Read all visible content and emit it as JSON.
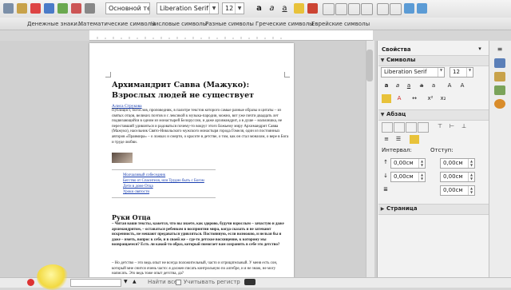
{
  "toolbar": {
    "para_style": "Основной текст",
    "font_name": "Liberation Serif",
    "font_size": "12"
  },
  "symbols": [
    "Денежные знаки...",
    "Математические символы",
    "Числовые символы",
    "Разные символы",
    "Греческие символы",
    "Еврейские символы"
  ],
  "doc": {
    "title": "Архимандрит Савва (Мажуко): Взрослых людей не существует",
    "author": "Алиса Струкова",
    "paragraph1": "Публицист, богослов, проповедник, в палитре текстов которого самые разные образы и цитаты – из святых отцов, великих поэтов и с лексикой к музыка-пародии, можно, вот уже почти двадцать лет подвизающийся в одном из монастырей Белоруссии, и даже архимандрит, а в душе – мальчишка, не переставший удивляться и радоваться почему-то вокруг этого Божьему миру Архимандрит Савва (Мажуко), насельник Свято-Никольского мужского монастыря города Гомеля, один из постоянных авторов «Правмира» – о ложках и смерти, о красоте в детстве, о том, как он стал монахом, о вере в Бога и труде любви.",
    "links": [
      "Молчаливый собеседник",
      "Бегство от Спасителя, или Трудно быть с Богом",
      "Дети в доме Отца",
      "Уроки святости"
    ],
    "heading2": "Руки Отца",
    "bold_para": "– Читая ваши тексты, кажется, что вы знаете, как здорово, будучи взрослым – зачастую и даже архимандритом, – оставаться ребенком в восприятии мира, когда сказать и не затевают искренность, не мешают предаваться удивляться. Постоянную, если возможно, и нельзя бы и даже – иметь, вопрос к себе, и в своей же – где-то детское восхищение, к которому мы возвращаемся? Есть ли какой-то образ, который помогает вам сохранять в себе это детство?",
    "para2": "– Но детство – это ведь опыт не всегда положительный, часто и отрицательный. У меня есть сон, который мне снится очень часто: я должен писать контрольную по алгебре, и я не знаю, не могу написать. Это ведь тоже опыт детства, да?"
  },
  "sidebar": {
    "title": "Свойства",
    "sections": {
      "symbols": "Символы",
      "paragraph": "Абзац",
      "page": "Страница"
    },
    "font_name": "Liberation Serif",
    "font_size": "12",
    "interval_label": "Интервал:",
    "indent_label": "Отступ:",
    "spin_values": [
      "0,00см",
      "0,00см",
      "0,00см",
      "0,00см",
      "0,00см"
    ]
  },
  "findbar": {
    "find_all": "Найти все",
    "match_case": "Учитывать регистр"
  },
  "colors": {
    "accent": "#1a3fb0",
    "highlight": "#f2d940"
  }
}
